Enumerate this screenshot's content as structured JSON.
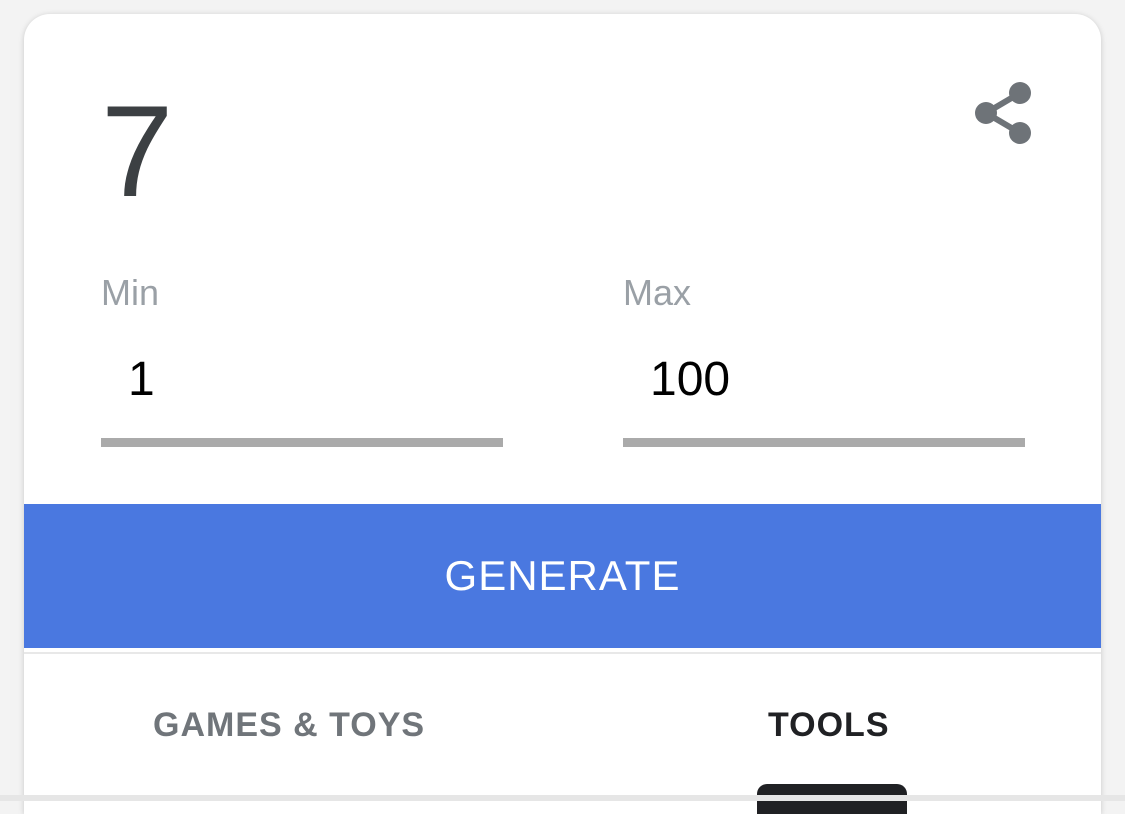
{
  "generator": {
    "result": "7",
    "share_icon": "share-icon",
    "min": {
      "label": "Min",
      "value": "1"
    },
    "max": {
      "label": "Max",
      "value": "100"
    },
    "generate_label": "GENERATE"
  },
  "tabs": [
    {
      "label": "GAMES & TOYS",
      "selected": false
    },
    {
      "label": "TOOLS",
      "selected": true
    }
  ],
  "colors": {
    "accent": "#4a78e0",
    "result_text": "#3c4043",
    "label_text": "#9aa0a6",
    "underline": "#aaaaaa",
    "tab_inactive": "#70757a",
    "tab_active": "#202124"
  }
}
